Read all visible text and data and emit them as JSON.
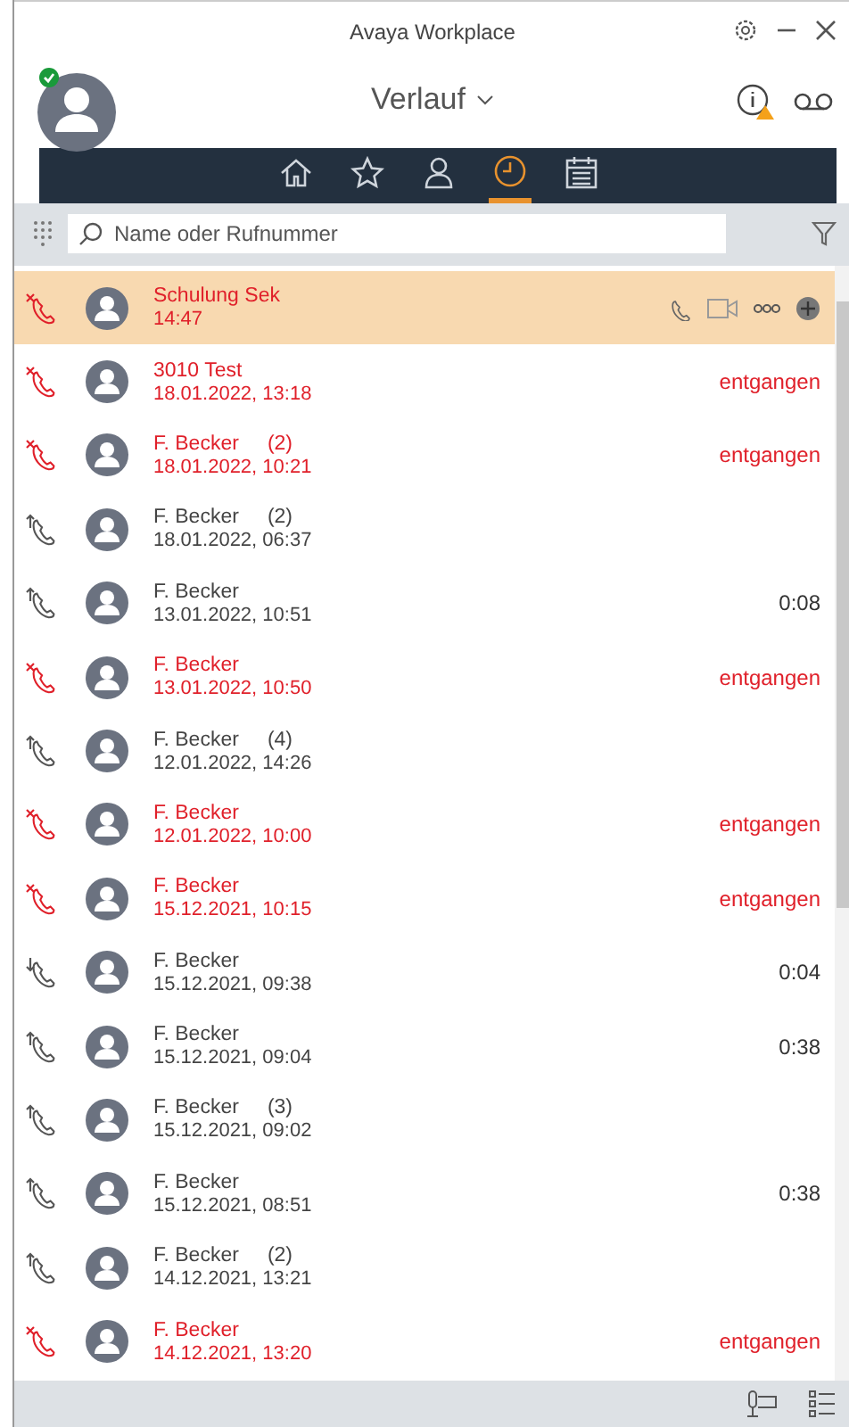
{
  "window": {
    "title": "Avaya Workplace"
  },
  "user": {
    "online": true
  },
  "view": {
    "title": "Verlauf"
  },
  "nav": [
    {
      "kind": "home",
      "selected": false
    },
    {
      "kind": "favorites",
      "selected": false
    },
    {
      "kind": "contacts",
      "selected": false
    },
    {
      "kind": "history",
      "selected": true
    },
    {
      "kind": "calendar",
      "selected": false
    }
  ],
  "search": {
    "placeholder": "Name oder Rufnummer"
  },
  "calls": [
    {
      "kind": "missed",
      "name": "Schulung Sek",
      "time": "14:47",
      "selected": true
    },
    {
      "kind": "missed",
      "name": "3010 Test",
      "time": "18.01.2022, 13:18",
      "info": "entgangen",
      "selected": false
    },
    {
      "kind": "missed",
      "name": "F. Becker",
      "count": "(2)",
      "time": "18.01.2022, 10:21",
      "info": "entgangen",
      "selected": false
    },
    {
      "kind": "outgoing",
      "name": "F. Becker",
      "count": "(2)",
      "time": "18.01.2022, 06:37",
      "selected": false
    },
    {
      "kind": "outgoing",
      "name": "F. Becker",
      "time": "13.01.2022, 10:51",
      "info": "0:08",
      "selected": false
    },
    {
      "kind": "missed",
      "name": "F. Becker",
      "time": "13.01.2022, 10:50",
      "info": "entgangen",
      "selected": false
    },
    {
      "kind": "outgoing",
      "name": "F. Becker",
      "count": "(4)",
      "time": "12.01.2022, 14:26",
      "selected": false
    },
    {
      "kind": "missed",
      "name": "F. Becker",
      "time": "12.01.2022, 10:00",
      "info": "entgangen",
      "selected": false
    },
    {
      "kind": "missed",
      "name": "F. Becker",
      "time": "15.12.2021, 10:15",
      "info": "entgangen",
      "selected": false
    },
    {
      "kind": "incoming",
      "name": "F. Becker",
      "time": "15.12.2021, 09:38",
      "info": "0:04",
      "selected": false
    },
    {
      "kind": "outgoing",
      "name": "F. Becker",
      "time": "15.12.2021, 09:04",
      "info": "0:38",
      "selected": false
    },
    {
      "kind": "outgoing",
      "name": "F. Becker",
      "count": "(3)",
      "time": "15.12.2021, 09:02",
      "selected": false
    },
    {
      "kind": "outgoing",
      "name": "F. Becker",
      "time": "15.12.2021, 08:51",
      "info": "0:38",
      "selected": false
    },
    {
      "kind": "outgoing",
      "name": "F. Becker",
      "count": "(2)",
      "time": "14.12.2021, 13:21",
      "selected": false
    },
    {
      "kind": "missed",
      "name": "F. Becker",
      "time": "14.12.2021, 13:20",
      "info": "entgangen",
      "selected": false
    }
  ]
}
